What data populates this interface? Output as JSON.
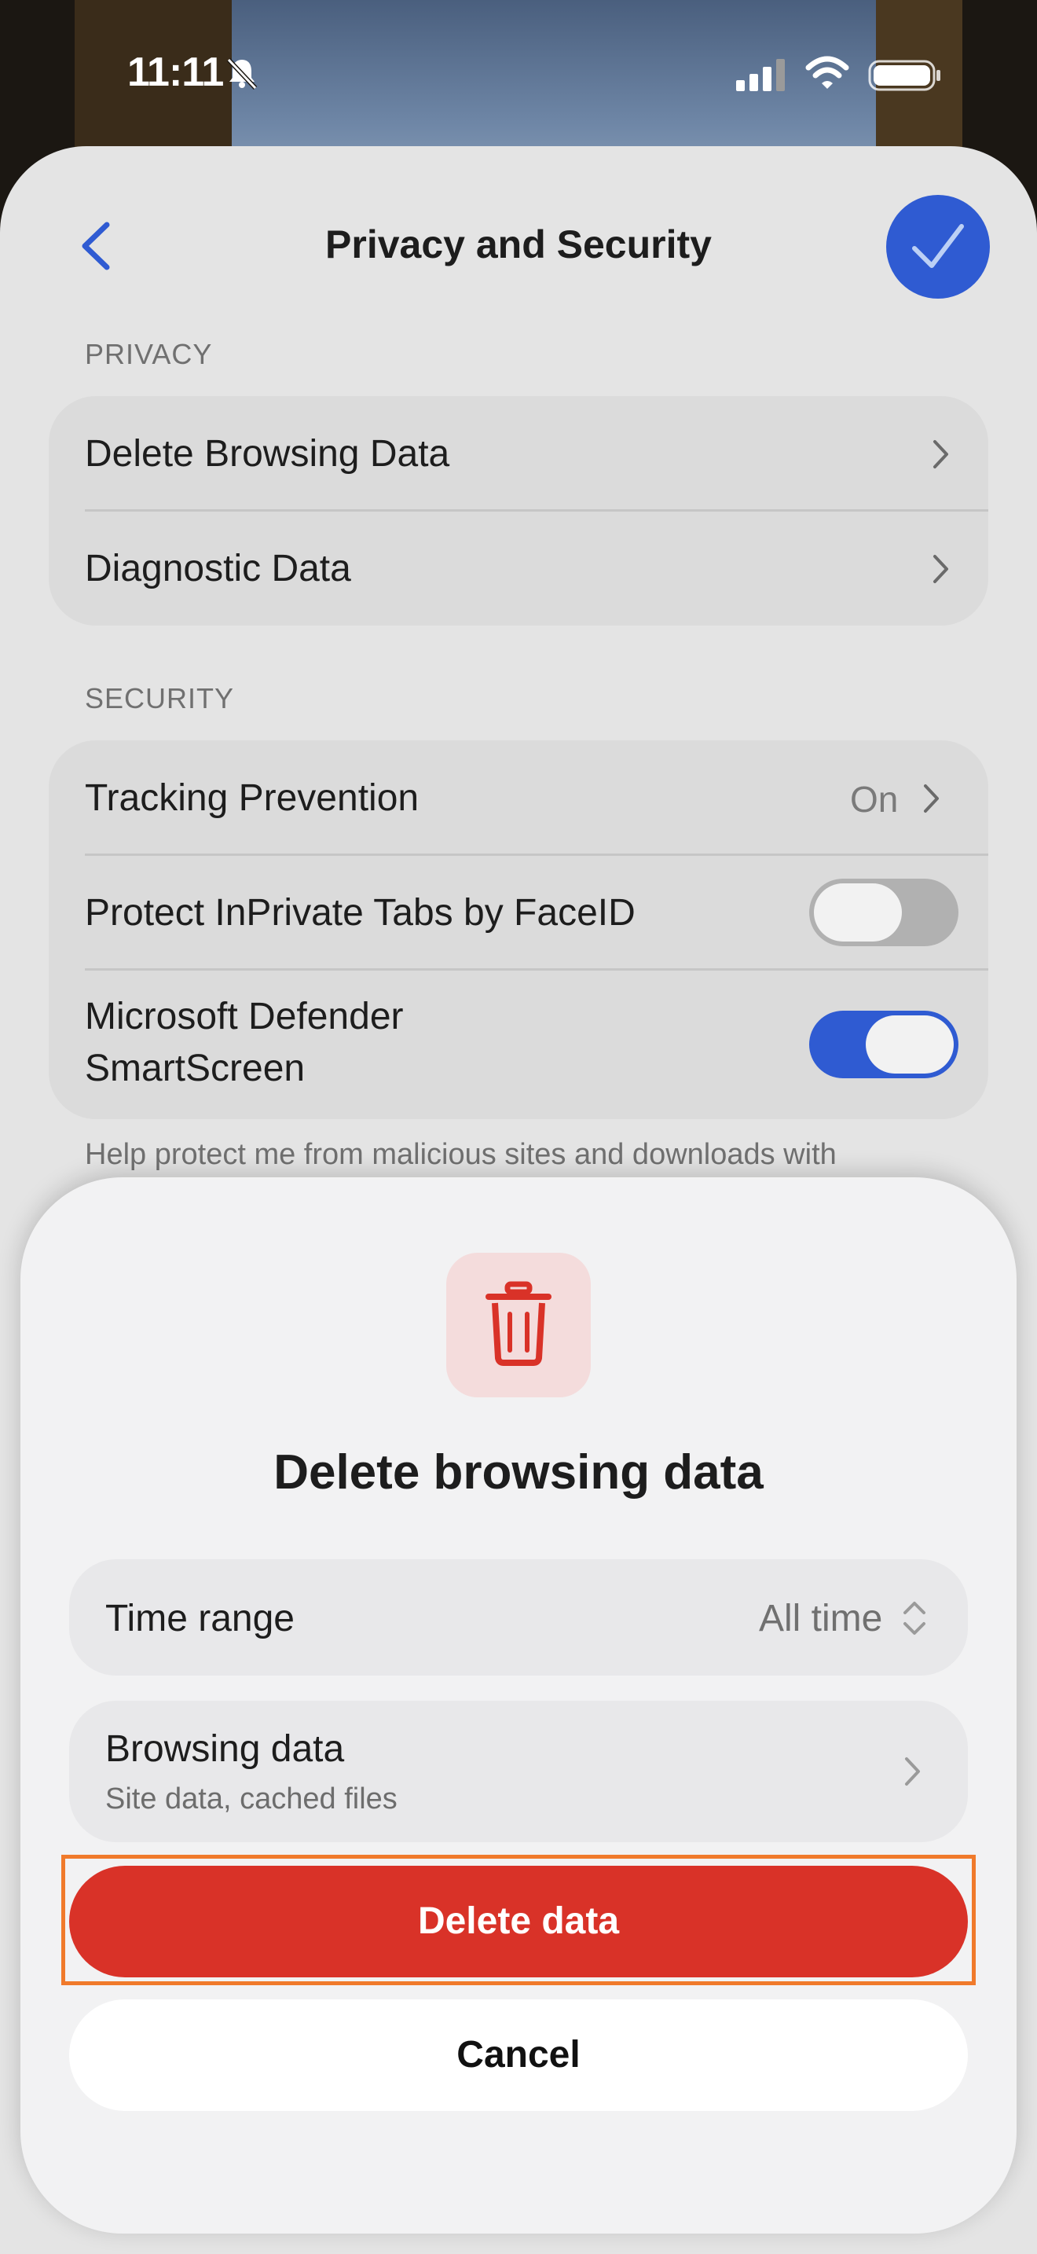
{
  "status_bar": {
    "time": "11:11"
  },
  "header": {
    "title": "Privacy and Security"
  },
  "privacy": {
    "section_label": "PRIVACY",
    "items": [
      {
        "label": "Delete Browsing Data"
      },
      {
        "label": "Diagnostic Data"
      }
    ]
  },
  "security": {
    "section_label": "SECURITY",
    "tracking": {
      "label": "Tracking Prevention",
      "value": "On"
    },
    "faceid": {
      "label": "Protect InPrivate Tabs by FaceID",
      "on": false
    },
    "smartscreen": {
      "label_line1": "Microsoft Defender",
      "label_line2": "SmartScreen",
      "on": true
    },
    "help_text": "Help protect me from malicious sites and downloads with"
  },
  "dialog": {
    "title": "Delete browsing data",
    "time_range": {
      "label": "Time range",
      "value": "All time"
    },
    "browsing_data": {
      "label": "Browsing data",
      "sub": "Site data, cached files"
    },
    "delete_label": "Delete data",
    "cancel_label": "Cancel"
  },
  "colors": {
    "accent": "#2f5bd2",
    "danger": "#d93228",
    "highlight": "#f07a2b"
  }
}
